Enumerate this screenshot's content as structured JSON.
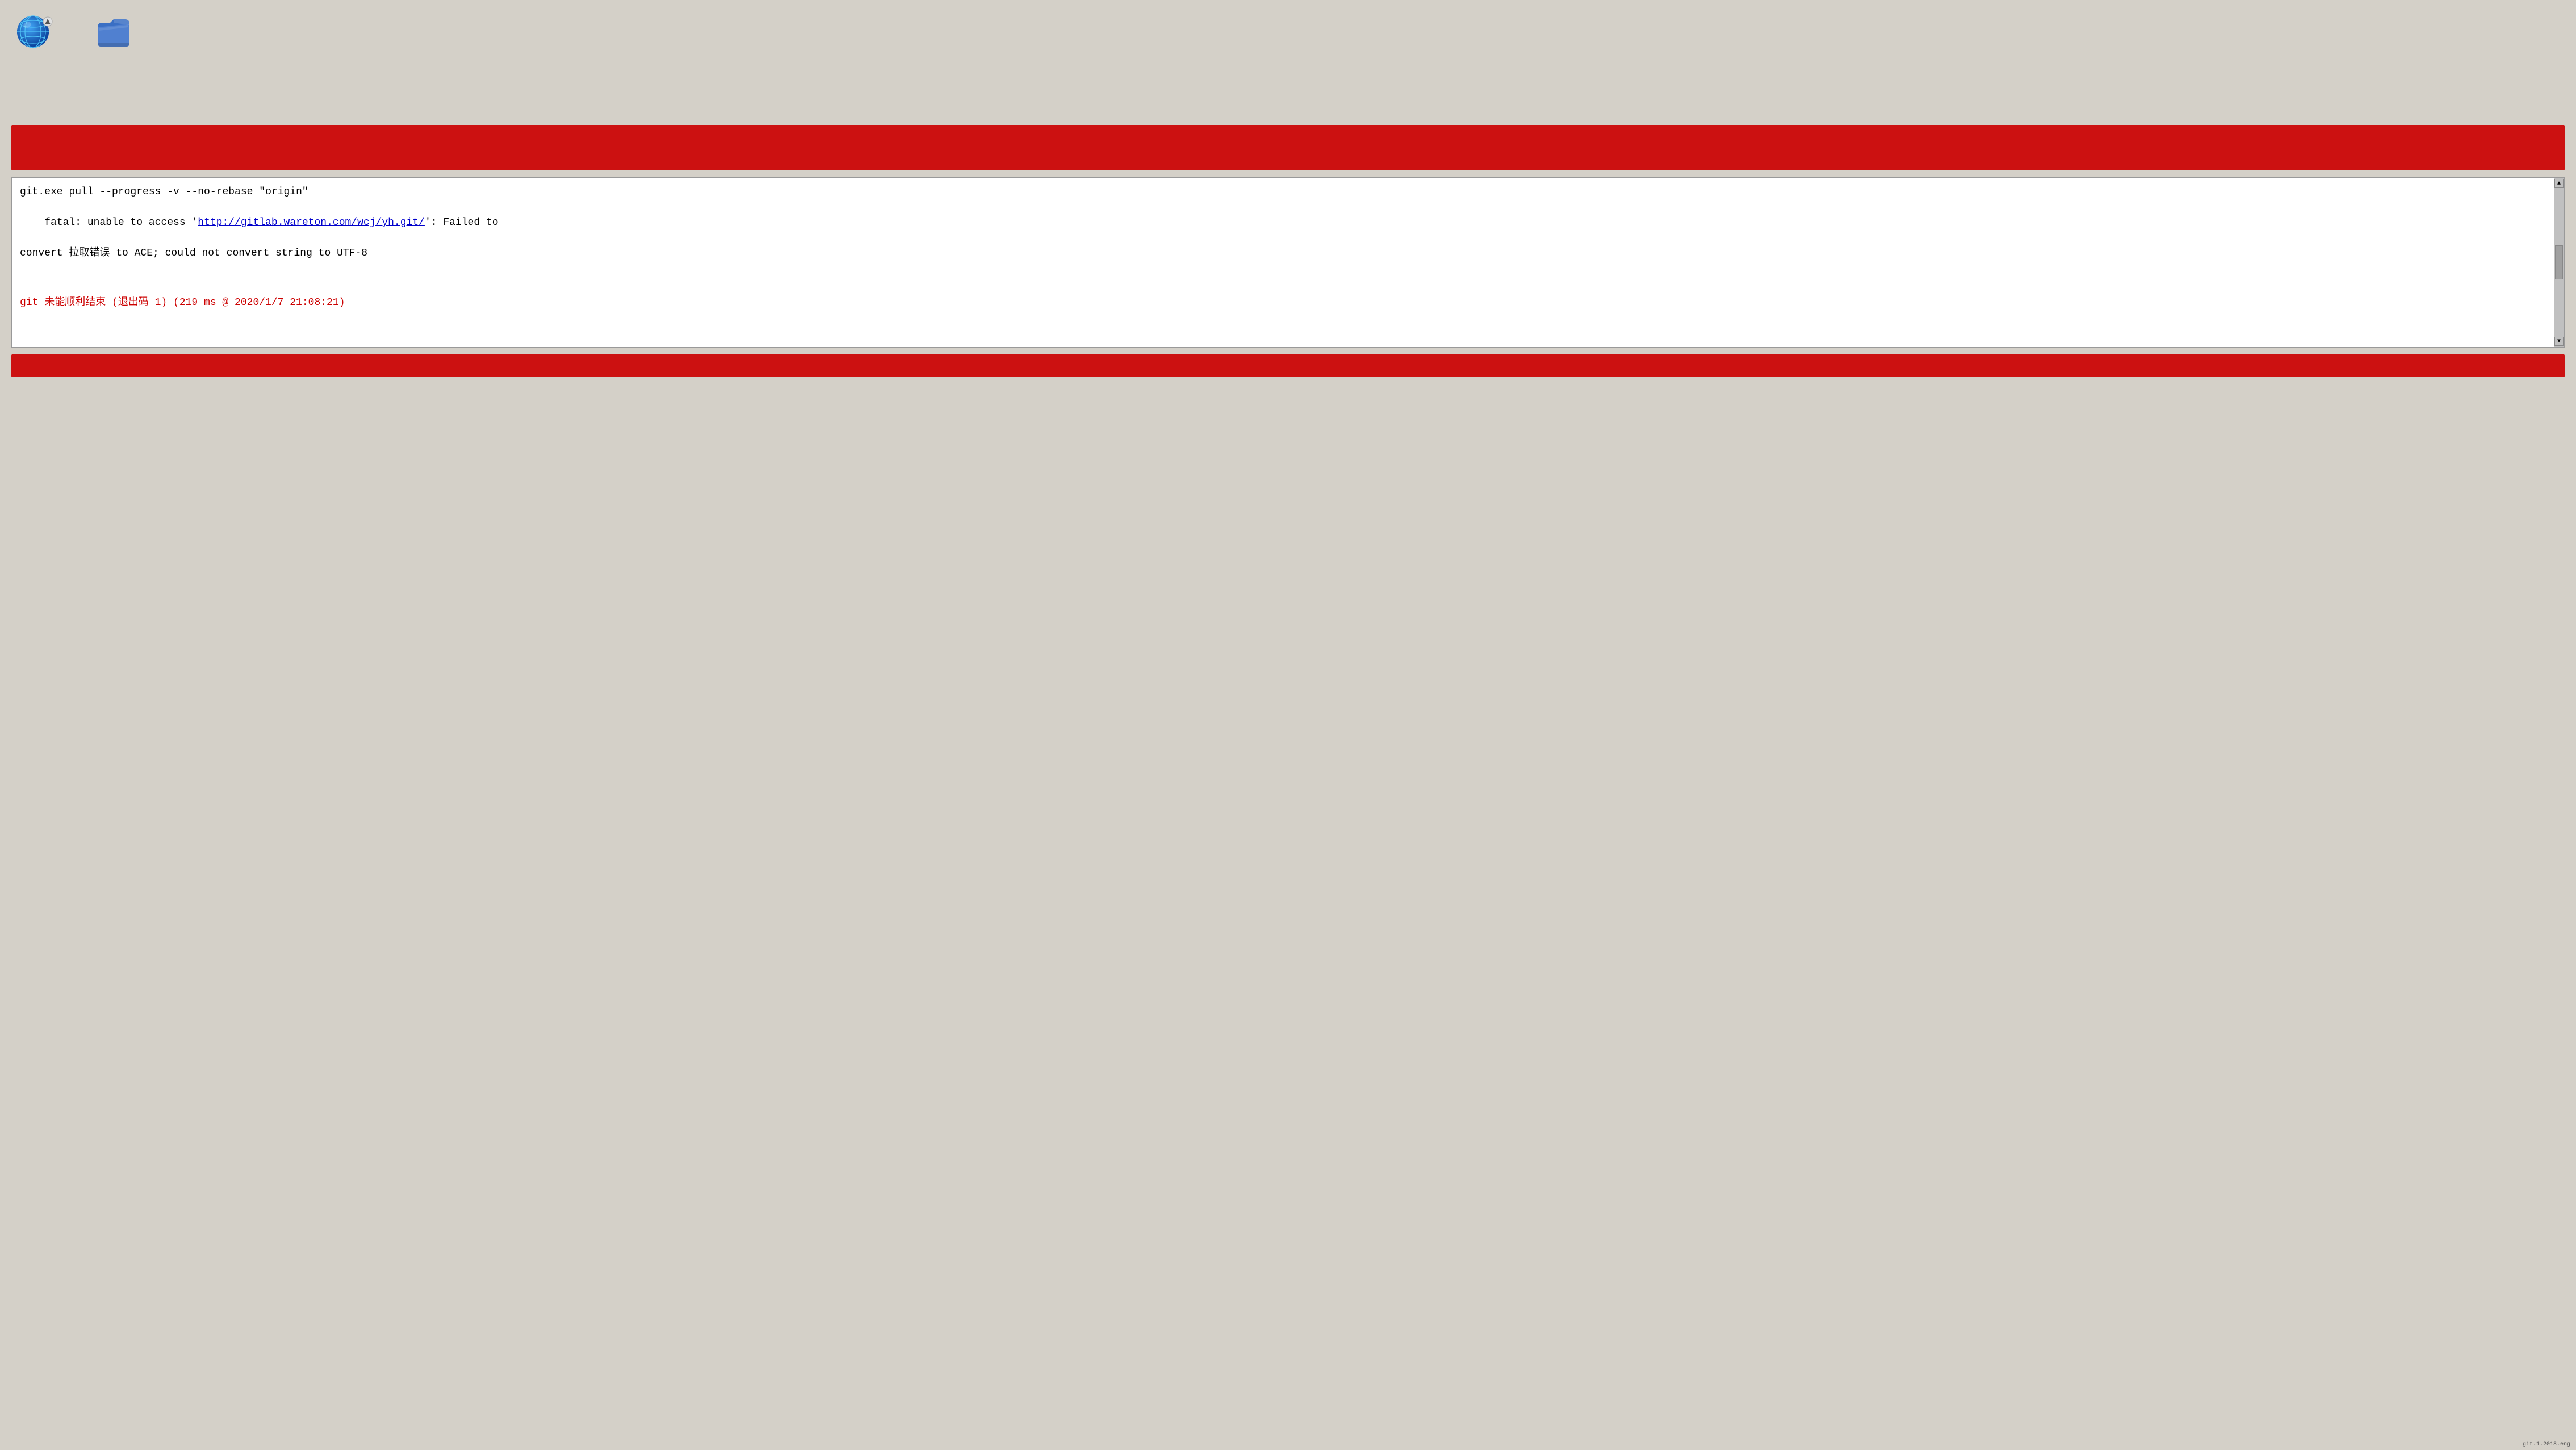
{
  "desktop": {
    "background_color": "#d4d0c8",
    "icons": [
      {
        "id": "globe-icon",
        "label": "",
        "type": "globe"
      },
      {
        "id": "folder-icon",
        "label": "",
        "type": "folder"
      }
    ]
  },
  "banner": {
    "color": "#cc1111"
  },
  "output": {
    "line1": "git.exe pull --progress -v --no-rebase \"origin\"",
    "line2_prefix": "fatal: unable to access '",
    "line2_link": "http://gitlab.wareton.com/wcj/yh.git/",
    "line2_suffix": "': Failed to",
    "line3": "convert 拉取错误 to ACE; could not convert string to UTF-8",
    "error_line": "git 未能顺利结束 (退出码 1) (219 ms @ 2020/1/7 21:08:21)"
  },
  "scrollbar": {
    "up_arrow": "▲",
    "down_arrow": "▼"
  },
  "statusbar": {
    "text": "git.1.2018.eng"
  }
}
